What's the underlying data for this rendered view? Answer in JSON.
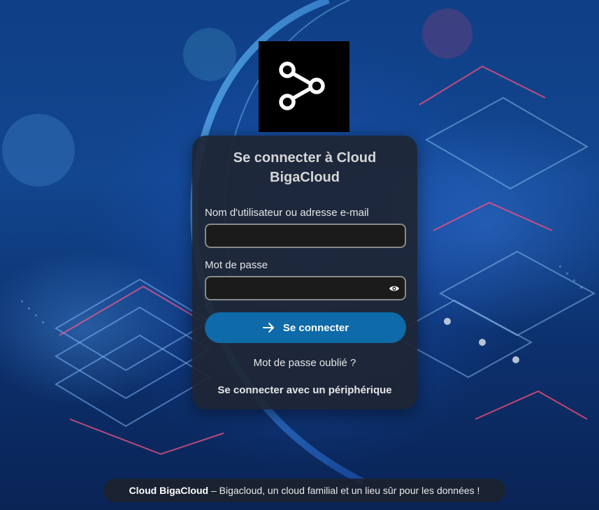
{
  "logo": {
    "icon": "share-nodes-icon",
    "background": "#000000"
  },
  "login": {
    "title": "Se connecter à Cloud BigaCloud",
    "username_label": "Nom d'utilisateur ou adresse e-mail",
    "username_value": "",
    "password_label": "Mot de passe",
    "password_value": "",
    "show_password_icon": "eye-icon",
    "submit_label": "Se connecter",
    "submit_icon": "arrow-right-icon",
    "forgot_password": "Mot de passe oublié ?",
    "device_login": "Se connecter avec un périphérique"
  },
  "footer": {
    "brand": "Cloud BigaCloud",
    "tagline": " – Bigacloud, un cloud familial et un lieu sûr pour les données !"
  },
  "colors": {
    "accent": "#0e6aa8",
    "card_background": "#1e2634",
    "page_background": "#12468f"
  }
}
